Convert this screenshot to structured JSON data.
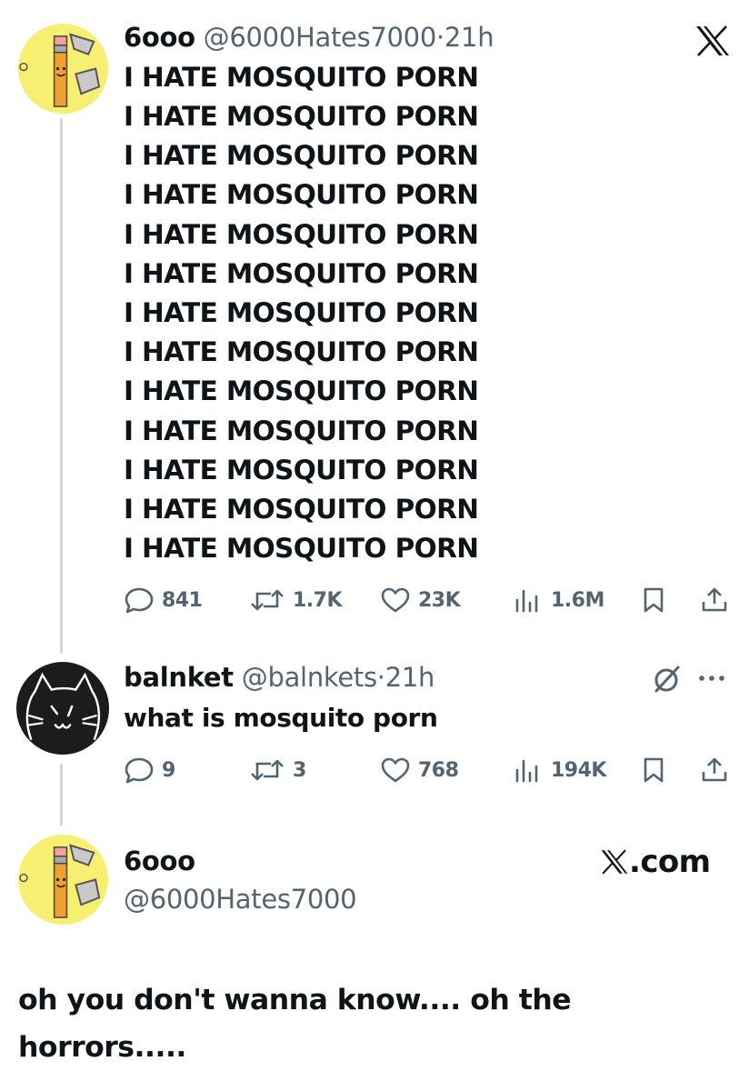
{
  "tweet1": {
    "display_name": "6ooo",
    "handle": "@6000Hates7000",
    "separator": "·",
    "time": "21h",
    "lines": [
      "I HATE MOSQUITO PORN",
      "I HATE MOSQUITO PORN",
      "I HATE MOSQUITO PORN",
      "I HATE MOSQUITO PORN",
      "I HATE MOSQUITO PORN",
      "I HATE MOSQUITO PORN",
      "I HATE MOSQUITO PORN",
      "I HATE MOSQUITO PORN",
      "I HATE MOSQUITO PORN",
      "I HATE MOSQUITO PORN",
      "I HATE MOSQUITO PORN",
      "I HATE MOSQUITO PORN",
      "I HATE MOSQUITO PORN"
    ],
    "stats": {
      "replies": "841",
      "reposts": "1.7K",
      "likes": "23K",
      "views": "1.6M"
    }
  },
  "tweet2": {
    "display_name": "balnket",
    "handle": "@balnkets",
    "separator": "·",
    "time": "21h",
    "text": "what is mosquito porn",
    "stats": {
      "replies": "9",
      "reposts": "3",
      "likes": "768",
      "views": "194K"
    }
  },
  "tweet3": {
    "display_name": "6ooo",
    "handle": "@6000Hates7000",
    "site": ".com",
    "text_lines": [
      "oh you don't wanna know.... oh the",
      "horrors....."
    ]
  },
  "icons": {
    "top_right": "x-logo-icon",
    "reply": "speech-bubble-icon",
    "repost": "repost-arrows-icon",
    "like": "heart-icon",
    "views": "bar-chart-icon",
    "bookmark": "bookmark-icon",
    "share": "share-upload-icon",
    "grok": "slashed-circle-icon",
    "more": "more-dots-icon"
  },
  "colors": {
    "text": "#0f1419",
    "secondary": "#536471",
    "thread_line": "#cfd9de",
    "avatar_yellow": "#f6ef72"
  }
}
